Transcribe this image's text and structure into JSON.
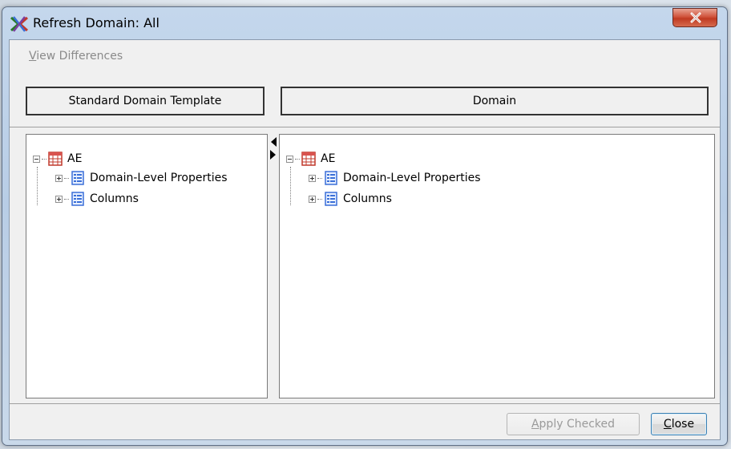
{
  "window": {
    "title": "Refresh Domain:  All",
    "close_glyph": "X"
  },
  "toolbar": {
    "view_differences_prefix": "V",
    "view_differences_rest": "iew Differences"
  },
  "headers": {
    "left": "Standard Domain Template",
    "right": "Domain"
  },
  "left_tree": {
    "root": {
      "label": "AE",
      "icon": "dataset-table-icon",
      "expanded": true
    },
    "children": [
      {
        "label": "Domain-Level Properties",
        "icon": "property-list-icon",
        "expanded": false
      },
      {
        "label": "Columns",
        "icon": "property-list-icon",
        "expanded": false
      }
    ]
  },
  "right_tree": {
    "root": {
      "label": "AE",
      "icon": "dataset-table-icon",
      "expanded": true
    },
    "children": [
      {
        "label": "Domain-Level Properties",
        "icon": "property-list-icon",
        "expanded": false
      },
      {
        "label": "Columns",
        "icon": "property-list-icon",
        "expanded": false
      }
    ]
  },
  "buttons": {
    "apply_prefix": "A",
    "apply_rest": "pply Checked",
    "apply_enabled": false,
    "close_prefix": "C",
    "close_rest": "lose"
  },
  "colors": {
    "title_bar": "#c4d7ec",
    "close_button": "#c03a22",
    "icon_blue": "#3a6fd8",
    "icon_red": "#c0392b"
  }
}
